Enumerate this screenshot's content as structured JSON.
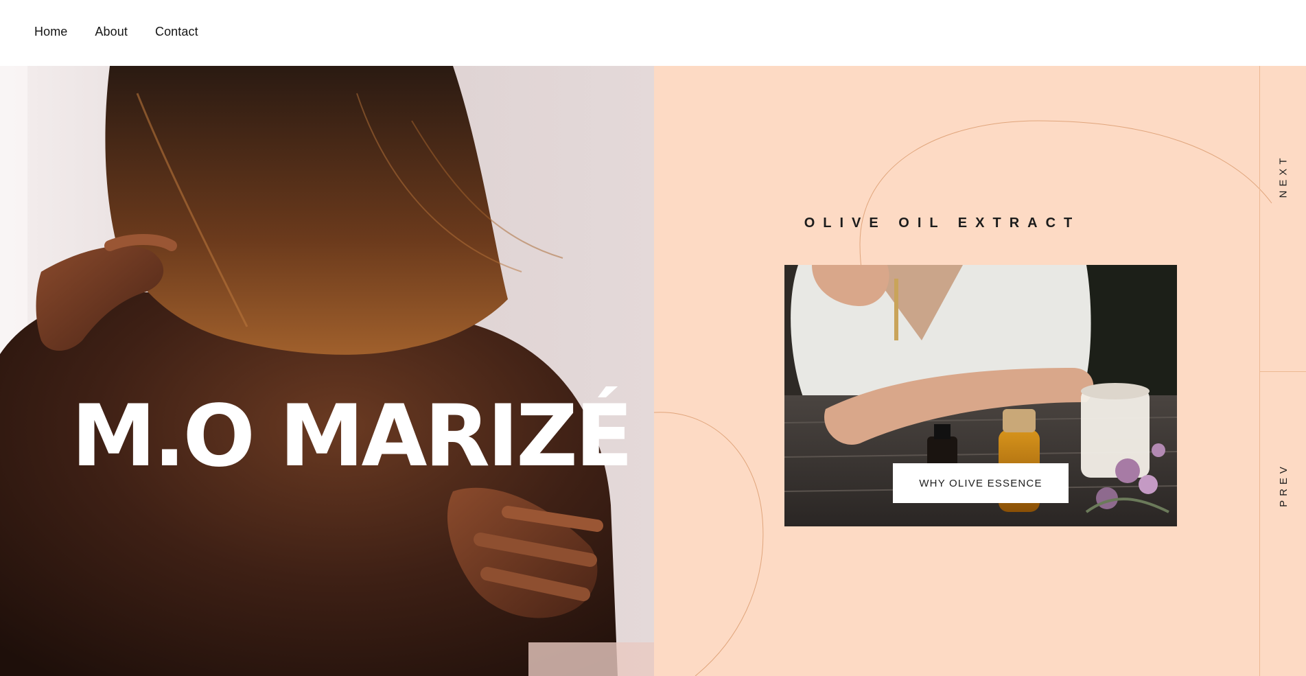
{
  "nav": {
    "items": [
      {
        "label": "Home"
      },
      {
        "label": "About"
      },
      {
        "label": "Contact"
      }
    ]
  },
  "hero": {
    "title": "M.O MARIZÉ"
  },
  "product": {
    "heading": "OLIVE OIL EXTRACT",
    "cta_label": "WHY OLIVE ESSENCE"
  },
  "rail": {
    "next_label": "NEXT",
    "prev_label": "PREV"
  },
  "colors": {
    "panel_bg": "#fddac4",
    "line_accent": "#e0a57c",
    "text_dark": "#1c1c1c",
    "white": "#ffffff"
  }
}
